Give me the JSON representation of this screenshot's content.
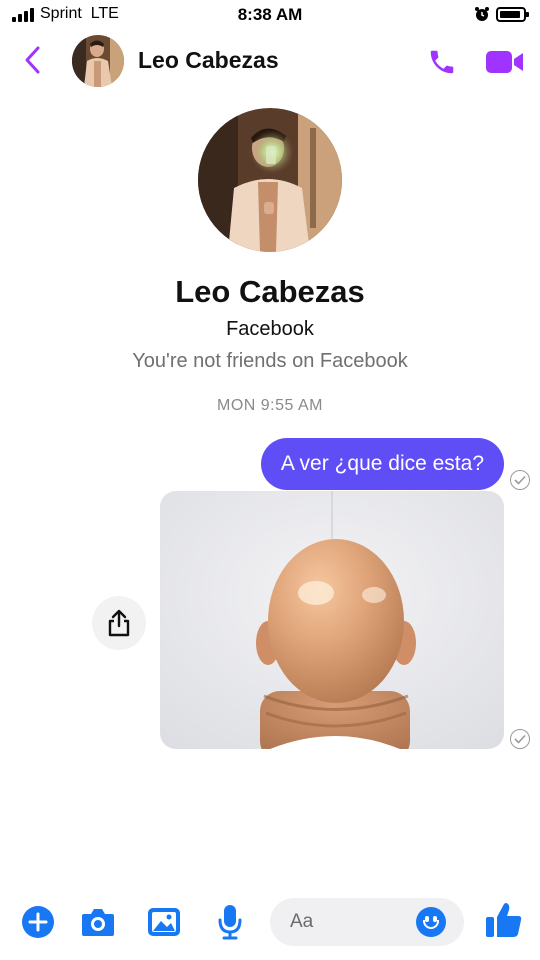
{
  "status_bar": {
    "carrier": "Sprint  LTE",
    "time": "8:38 AM",
    "icons": [
      "signal-icon",
      "alarm-icon",
      "battery-icon"
    ]
  },
  "header": {
    "back_icon": "chevron-left-icon",
    "contact_name": "Leo Cabezas",
    "call_icon": "phone-icon",
    "video_icon": "video-camera-icon"
  },
  "profile": {
    "name": "Leo Cabezas",
    "source": "Facebook",
    "friend_status": "You're not friends on Facebook"
  },
  "conversation": {
    "timestamp": "MON 9:55 AM",
    "messages": [
      {
        "type": "text",
        "text": "A ver ¿que dice esta?",
        "sent": true,
        "status": "sent"
      },
      {
        "type": "image",
        "subject": "back of a bald head",
        "sent": true,
        "status": "sent"
      }
    ],
    "share_icon": "share-icon"
  },
  "composer": {
    "placeholder": "Aa",
    "icons": [
      "plus-icon",
      "camera-icon",
      "gallery-icon",
      "microphone-icon",
      "emoji-icon",
      "thumbs-up-icon"
    ]
  },
  "colors": {
    "accent_purple": "#a033ff",
    "bubble": "#5f4df5",
    "messenger_blue": "#1877f2"
  }
}
